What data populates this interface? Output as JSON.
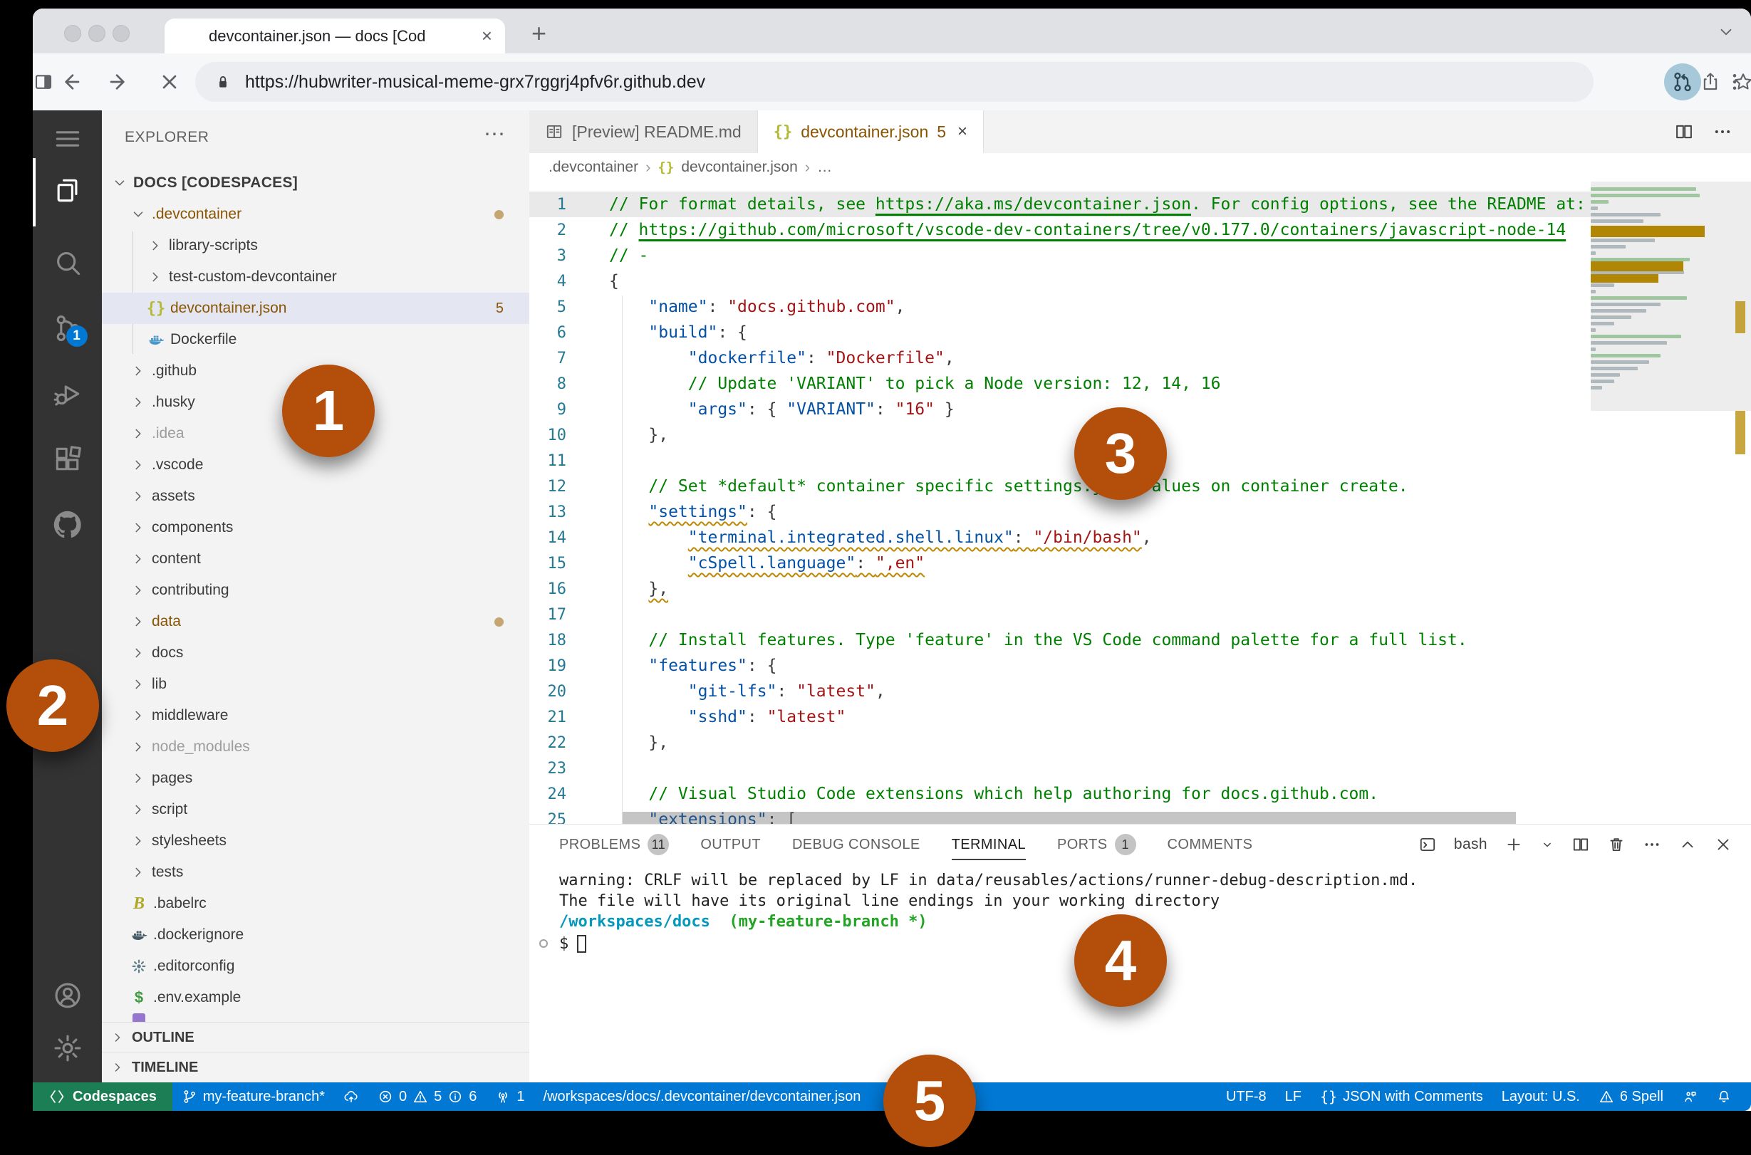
{
  "browser": {
    "tab": {
      "title": "devcontainer.json — docs [Cod",
      "close": "×"
    },
    "new_tab": "+",
    "url": "https://hubwriter-musical-meme-grx7rggrj4pfv6r.github.dev"
  },
  "activity_bar": {
    "scm_badge": "1"
  },
  "explorer": {
    "header": "EXPLORER",
    "more": "⋯",
    "root": "DOCS [CODESPACES]",
    "items": [
      {
        "label": ".devcontainer",
        "lv": 1,
        "chev": "d",
        "cls": "mod",
        "dot": true
      },
      {
        "label": "library-scripts",
        "lv": 2,
        "chev": "r"
      },
      {
        "label": "test-custom-devcontainer",
        "lv": 2,
        "chev": "r"
      },
      {
        "label": "devcontainer.json",
        "lv": 2,
        "icon": "braces",
        "cls": "mod sel",
        "badge": "5"
      },
      {
        "label": "Dockerfile",
        "lv": 2,
        "icon": "docker"
      },
      {
        "label": ".github",
        "lv": 1,
        "chev": "r"
      },
      {
        "label": ".husky",
        "lv": 1,
        "chev": "r"
      },
      {
        "label": ".idea",
        "lv": 1,
        "chev": "r",
        "cls": "ign"
      },
      {
        "label": ".vscode",
        "lv": 1,
        "chev": "r"
      },
      {
        "label": "assets",
        "lv": 1,
        "chev": "r"
      },
      {
        "label": "components",
        "lv": 1,
        "chev": "r"
      },
      {
        "label": "content",
        "lv": 1,
        "chev": "r"
      },
      {
        "label": "contributing",
        "lv": 1,
        "chev": "r"
      },
      {
        "label": "data",
        "lv": 1,
        "chev": "r",
        "cls": "mod",
        "dot": true
      },
      {
        "label": "docs",
        "lv": 1,
        "chev": "r"
      },
      {
        "label": "lib",
        "lv": 1,
        "chev": "r"
      },
      {
        "label": "middleware",
        "lv": 1,
        "chev": "r"
      },
      {
        "label": "node_modules",
        "lv": 1,
        "chev": "r",
        "cls": "ign"
      },
      {
        "label": "pages",
        "lv": 1,
        "chev": "r"
      },
      {
        "label": "script",
        "lv": 1,
        "chev": "r"
      },
      {
        "label": "stylesheets",
        "lv": 1,
        "chev": "r"
      },
      {
        "label": "tests",
        "lv": 1,
        "chev": "r"
      },
      {
        "label": ".babelrc",
        "lv": 1,
        "icon": "babel"
      },
      {
        "label": ".dockerignore",
        "lv": 1,
        "icon": "dockerdark"
      },
      {
        "label": ".editorconfig",
        "lv": 1,
        "icon": "gearfile"
      },
      {
        "label": ".env.example",
        "lv": 1,
        "icon": "env"
      },
      {
        "label": "",
        "lv": 1,
        "icon": "purple",
        "partial": true
      }
    ],
    "panels": [
      "OUTLINE",
      "TIMELINE"
    ]
  },
  "editor": {
    "tabs": [
      {
        "label": "[Preview] README.md",
        "icon": "mdpreview",
        "active": false
      },
      {
        "label": "devcontainer.json",
        "icon": "braces",
        "badge": "5",
        "close": "×",
        "active": true
      }
    ],
    "breadcrumb": [
      ".devcontainer",
      "devcontainer.json",
      "…"
    ],
    "code": [
      {
        "n": 1,
        "hl": true,
        "seg": [
          [
            "c",
            "// For format details, see "
          ],
          [
            "cl",
            "https://aka.ms/devcontainer.json"
          ],
          [
            "c",
            ". For config options, see the README at:"
          ]
        ]
      },
      {
        "n": 2,
        "seg": [
          [
            "c",
            "// "
          ],
          [
            "cl",
            "https://github.com/microsoft/vscode-dev-containers/tree/v0.177.0/containers/javascript-node-14"
          ]
        ]
      },
      {
        "n": 3,
        "seg": [
          [
            "c",
            "// -"
          ]
        ]
      },
      {
        "n": 4,
        "seg": [
          [
            "p",
            "{"
          ]
        ]
      },
      {
        "n": 5,
        "seg": [
          [
            "p",
            "    "
          ],
          [
            "k",
            "\"name\""
          ],
          [
            "p",
            ": "
          ],
          [
            "s",
            "\"docs.github.com\""
          ],
          [
            "p",
            ","
          ]
        ]
      },
      {
        "n": 6,
        "seg": [
          [
            "p",
            "    "
          ],
          [
            "k",
            "\"build\""
          ],
          [
            "p",
            ": {"
          ]
        ]
      },
      {
        "n": 7,
        "seg": [
          [
            "p",
            "        "
          ],
          [
            "k",
            "\"dockerfile\""
          ],
          [
            "p",
            ": "
          ],
          [
            "s",
            "\"Dockerfile\""
          ],
          [
            "p",
            ","
          ]
        ]
      },
      {
        "n": 8,
        "seg": [
          [
            "p",
            "        "
          ],
          [
            "c",
            "// Update 'VARIANT' to pick a Node version: 12, 14, 16"
          ]
        ]
      },
      {
        "n": 9,
        "seg": [
          [
            "p",
            "        "
          ],
          [
            "k",
            "\"args\""
          ],
          [
            "p",
            ": { "
          ],
          [
            "k",
            "\"VARIANT\""
          ],
          [
            "p",
            ": "
          ],
          [
            "s",
            "\"16\""
          ],
          [
            "p",
            " }"
          ]
        ]
      },
      {
        "n": 10,
        "seg": [
          [
            "p",
            "    },"
          ]
        ]
      },
      {
        "n": 11,
        "seg": []
      },
      {
        "n": 12,
        "seg": [
          [
            "p",
            "    "
          ],
          [
            "c",
            "// Set *default* container specific settings.json values on container create."
          ]
        ]
      },
      {
        "n": 13,
        "seg": [
          [
            "p",
            "    "
          ],
          [
            "k",
            "\"settings\"",
            1
          ],
          [
            "p",
            ": {"
          ]
        ]
      },
      {
        "n": 14,
        "seg": [
          [
            "p",
            "        "
          ],
          [
            "k",
            "\"terminal.integrated.shell.linux\"",
            1
          ],
          [
            "p",
            ": ",
            1
          ],
          [
            "s",
            "\"/bin/bash\"",
            1
          ],
          [
            "p",
            ","
          ]
        ]
      },
      {
        "n": 15,
        "seg": [
          [
            "p",
            "        "
          ],
          [
            "k",
            "\"cSpell.language\"",
            1
          ],
          [
            "p",
            ": ",
            1
          ],
          [
            "s",
            "\",en\"",
            1
          ]
        ]
      },
      {
        "n": 16,
        "seg": [
          [
            "p",
            "    "
          ],
          [
            "p",
            "},",
            1
          ]
        ]
      },
      {
        "n": 17,
        "seg": []
      },
      {
        "n": 18,
        "seg": [
          [
            "p",
            "    "
          ],
          [
            "c",
            "// Install features. Type 'feature' in the VS Code command palette for a full list."
          ]
        ]
      },
      {
        "n": 19,
        "seg": [
          [
            "p",
            "    "
          ],
          [
            "k",
            "\"features\""
          ],
          [
            "p",
            ": {"
          ]
        ]
      },
      {
        "n": 20,
        "seg": [
          [
            "p",
            "        "
          ],
          [
            "k",
            "\"git-lfs\""
          ],
          [
            "p",
            ": "
          ],
          [
            "s",
            "\"latest\""
          ],
          [
            "p",
            ","
          ]
        ]
      },
      {
        "n": 21,
        "seg": [
          [
            "p",
            "        "
          ],
          [
            "k",
            "\"sshd\""
          ],
          [
            "p",
            ": "
          ],
          [
            "s",
            "\"latest\""
          ]
        ]
      },
      {
        "n": 22,
        "seg": [
          [
            "p",
            "    },"
          ]
        ]
      },
      {
        "n": 23,
        "seg": []
      },
      {
        "n": 24,
        "seg": [
          [
            "p",
            "    "
          ],
          [
            "c",
            "// Visual Studio Code extensions which help authoring for docs.github.com."
          ]
        ]
      },
      {
        "n": 25,
        "seg": [
          [
            "p",
            "    "
          ],
          [
            "k",
            "\"extensions\""
          ],
          [
            "p",
            ": ["
          ]
        ]
      }
    ]
  },
  "panel": {
    "tabs": [
      {
        "label": "PROBLEMS",
        "badge": "11"
      },
      {
        "label": "OUTPUT"
      },
      {
        "label": "DEBUG CONSOLE"
      },
      {
        "label": "TERMINAL",
        "active": true
      },
      {
        "label": "PORTS",
        "badge": "1"
      },
      {
        "label": "COMMENTS"
      }
    ],
    "shell_label": "bash",
    "terminal": {
      "lines": [
        "warning: CRLF will be replaced by LF in data/reusables/actions/runner-debug-description.md.",
        "The file will have its original line endings in your working directory"
      ],
      "cwd": "/workspaces/docs",
      "branch": "(my-feature-branch *)",
      "prompt": "$"
    }
  },
  "status_bar": {
    "remote": "Codespaces",
    "branch": "my-feature-branch*",
    "errors": "0",
    "warnings": "5",
    "infos": "6",
    "ports": "1",
    "path": "/workspaces/docs/.devcontainer/devcontainer.json",
    "encoding": "UTF-8",
    "eol": "LF",
    "language": "JSON with Comments",
    "layout": "Layout: U.S.",
    "spell": "6 Spell"
  },
  "callouts": [
    "1",
    "2",
    "3",
    "4",
    "5"
  ],
  "colors": {
    "status_blue": "#0078d4",
    "remote_green": "#1b7e54",
    "callout_orange": "#b34e0b",
    "modified_olive": "#895503",
    "comment_green": "#008000",
    "key_blue": "#0451a5",
    "string_red": "#a31515"
  }
}
